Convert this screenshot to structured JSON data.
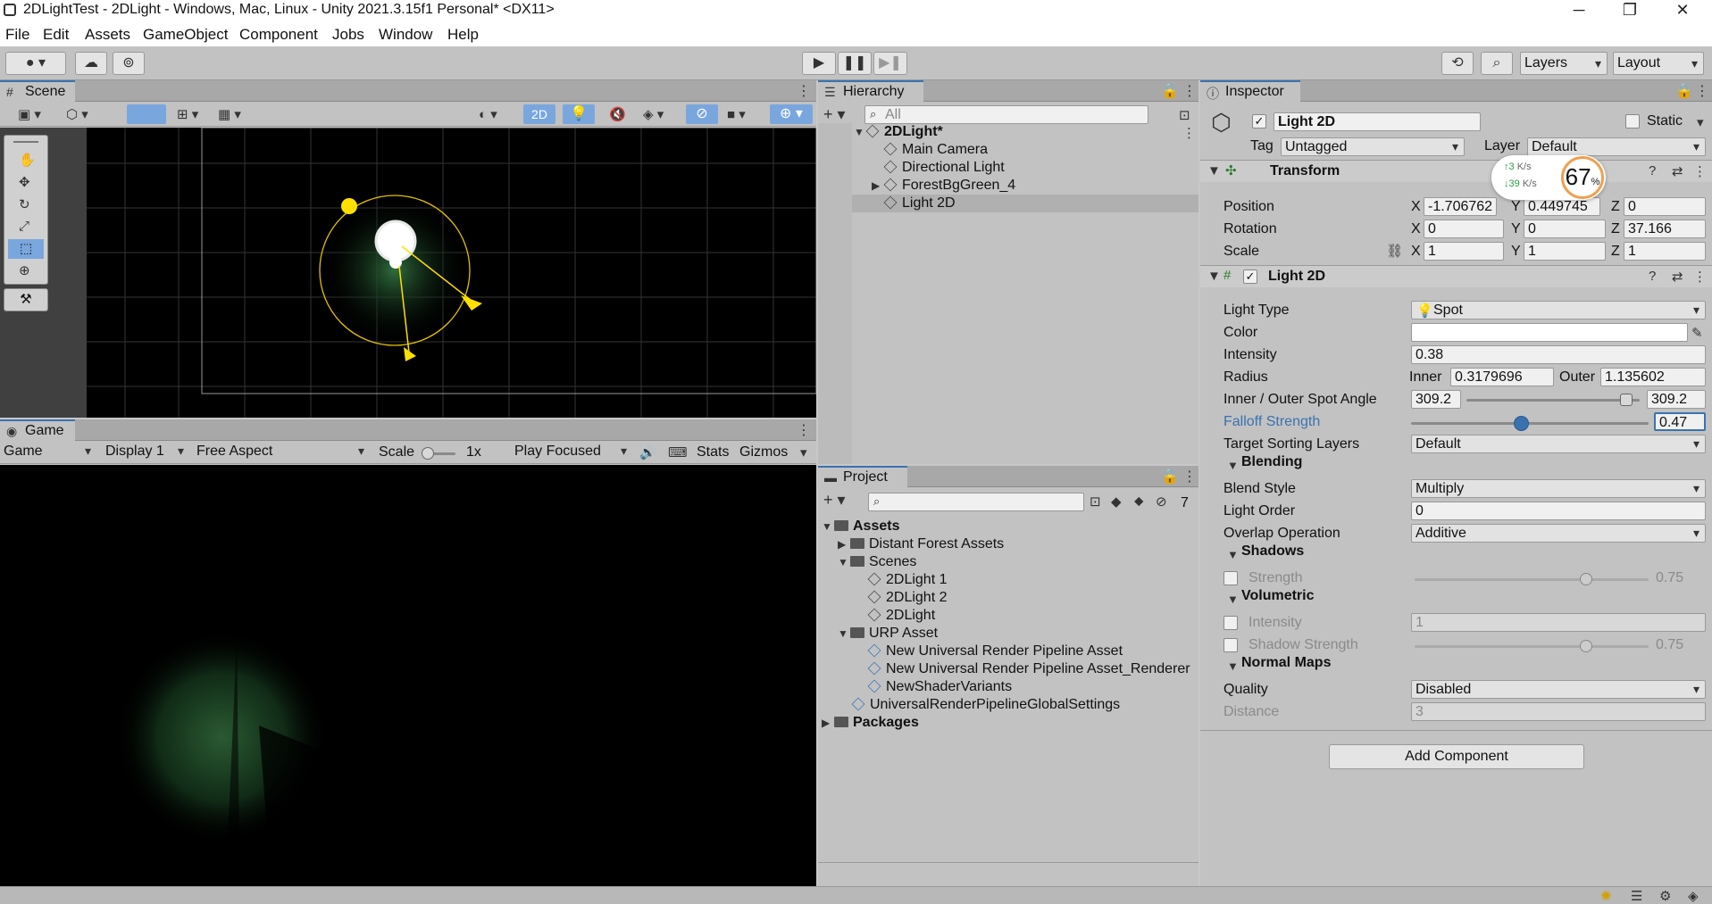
{
  "window": {
    "title": "2DLightTest - 2DLight - Windows, Mac, Linux - Unity 2021.3.15f1 Personal* <DX11>",
    "minimize": "─",
    "maximize": "❐",
    "close": "✕"
  },
  "menu": [
    "File",
    "Edit",
    "Assets",
    "GameObject",
    "Component",
    "Jobs",
    "Window",
    "Help"
  ],
  "toolbar": {
    "layers": "Layers",
    "layout": "Layout"
  },
  "scene": {
    "tab": "Scene",
    "mode2d": "2D"
  },
  "game": {
    "tab": "Game",
    "view": "Game",
    "display": "Display 1",
    "aspect": "Free Aspect",
    "scale_label": "Scale",
    "scale_value": "1x",
    "play_mode": "Play Focused",
    "stats": "Stats",
    "gizmos": "Gizmos"
  },
  "hierarchy": {
    "tab": "Hierarchy",
    "search_placeholder": "All",
    "root": "2DLight*",
    "items": [
      "Main Camera",
      "Directional Light",
      "ForestBgGreen_4",
      "Light 2D"
    ]
  },
  "project": {
    "tab": "Project",
    "hidden_count": "7",
    "assets": "Assets",
    "items": [
      {
        "label": "Distant Forest Assets"
      },
      {
        "label": "Scenes"
      },
      {
        "label": "2DLight 1"
      },
      {
        "label": "2DLight 2"
      },
      {
        "label": "2DLight"
      },
      {
        "label": "URP Asset"
      },
      {
        "label": "New Universal Render Pipeline Asset"
      },
      {
        "label": "New Universal Render Pipeline Asset_Renderer"
      },
      {
        "label": "NewShaderVariants"
      },
      {
        "label": "UniversalRenderPipelineGlobalSettings"
      }
    ],
    "packages": "Packages"
  },
  "inspector": {
    "tab": "Inspector",
    "object_name": "Light 2D",
    "static": "Static",
    "tag_label": "Tag",
    "tag_value": "Untagged",
    "layer_label": "Layer",
    "layer_value": "Default",
    "transform": {
      "title": "Transform",
      "position_label": "Position",
      "pos_x": "-1.706762",
      "pos_y": "0.449745",
      "pos_z": "0",
      "rotation_label": "Rotation",
      "rot_x": "0",
      "rot_y": "0",
      "rot_z": "37.166",
      "scale_label": "Scale",
      "scale_x": "1",
      "scale_y": "1",
      "scale_z": "1"
    },
    "light2d": {
      "title": "Light 2D",
      "light_type_label": "Light Type",
      "light_type": "Spot",
      "color_label": "Color",
      "intensity_label": "Intensity",
      "intensity": "0.38",
      "radius_label": "Radius",
      "inner_label": "Inner",
      "inner": "0.3179696",
      "outer_label": "Outer",
      "outer": "1.135602",
      "spot_angle_label": "Inner / Outer Spot Angle",
      "spot_inner": "309.2",
      "spot_outer": "309.2",
      "falloff_label": "Falloff Strength",
      "falloff": "0.47",
      "sorting_label": "Target Sorting Layers",
      "sorting": "Default",
      "blending_title": "Blending",
      "blend_style_label": "Blend Style",
      "blend_style": "Multiply",
      "light_order_label": "Light Order",
      "light_order": "0",
      "overlap_label": "Overlap Operation",
      "overlap": "Additive",
      "shadows_title": "Shadows",
      "shadow_strength_label": "Strength",
      "shadow_strength": "0.75",
      "volumetric_title": "Volumetric",
      "vol_intensity_label": "Intensity",
      "vol_intensity": "1",
      "vol_shadow_label": "Shadow Strength",
      "vol_shadow": "0.75",
      "normal_title": "Normal Maps",
      "quality_label": "Quality",
      "quality": "Disabled",
      "distance_label": "Distance",
      "distance": "3"
    },
    "add_component": "Add Component"
  },
  "net_overlay": {
    "up": "3",
    "up_unit": "K/s",
    "down": "39",
    "down_unit": "K/s",
    "percent": "67",
    "percent_sign": "%"
  },
  "colors": {
    "accent": "#3a72b0",
    "gizmo": "#ffe000",
    "scene_bg": "#000000"
  }
}
